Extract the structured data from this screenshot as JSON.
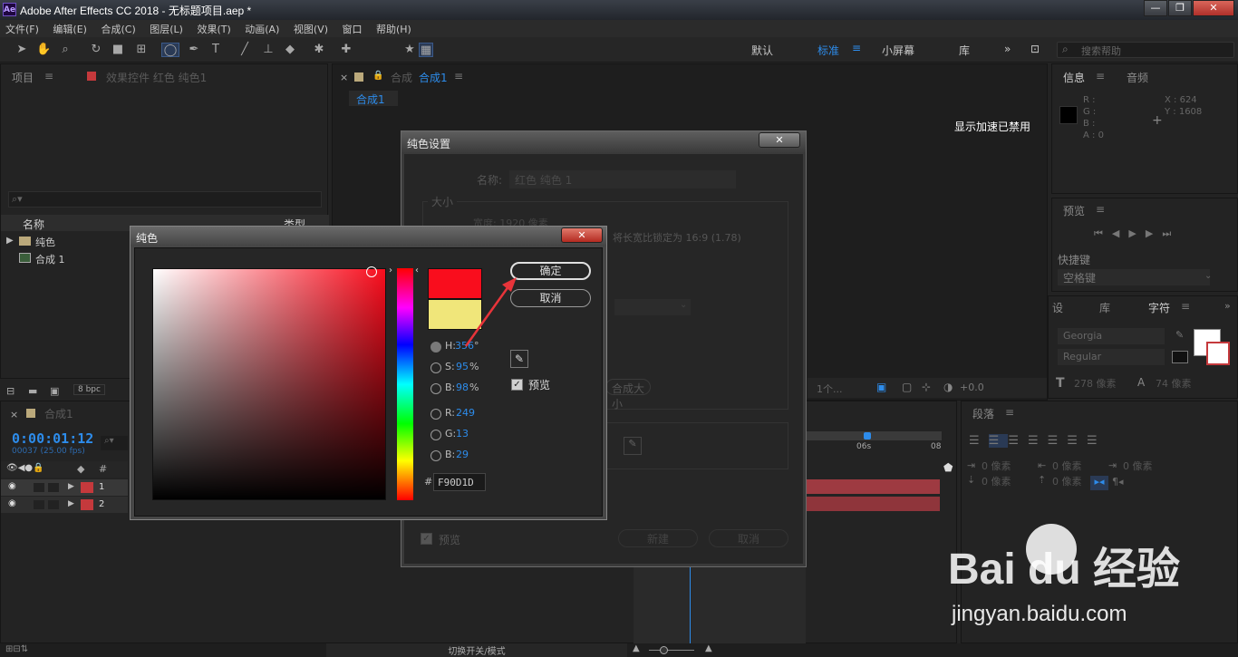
{
  "titlebar": {
    "logo": "Ae",
    "title": "Adobe After Effects CC 2018 - 无标题项目.aep *",
    "minimize": "—",
    "restore": "❐",
    "close": "✕"
  },
  "menu": [
    "文件(F)",
    "编辑(E)",
    "合成(C)",
    "图层(L)",
    "效果(T)",
    "动画(A)",
    "视图(V)",
    "窗口",
    "帮助(H)"
  ],
  "workspaces": [
    "默认",
    "标准",
    "小屏幕",
    "库"
  ],
  "search_placeholder": "搜索帮助",
  "project_panel": {
    "tab_project": "项目",
    "tab_effects": "效果控件 红色 纯色1",
    "col_name": "名称",
    "col_type": "类型",
    "items": [
      "纯色",
      "合成 1"
    ],
    "bpc": "8 bpc"
  },
  "comp_panel": {
    "tab_label": "合成",
    "tab_name": "合成1",
    "subtab": "合成1",
    "gpu_notice": "显示加速已禁用",
    "view_count": "1个...",
    "exposure": "+0.0"
  },
  "timeline": {
    "tab_name": "合成1",
    "timecode": "0:00:01:12",
    "frames": "00037 (25.00 fps)",
    "col_num": "#",
    "rows": [
      {
        "num": "1",
        "color": "#c5393c"
      },
      {
        "num": "2",
        "color": "#c5393c"
      }
    ],
    "ruler_marks": [
      "06s",
      "08"
    ],
    "footer_toggle": "切换开关/模式"
  },
  "info_panel": {
    "tab_info": "信息",
    "tab_audio": "音频",
    "r": "R :",
    "g": "G :",
    "b": "B :",
    "a": "A : 0",
    "x": "X : 624",
    "y": "Y : 1608"
  },
  "preview_panel": {
    "tab": "预览",
    "shortcut_label": "快捷键",
    "shortcut_value": "空格键"
  },
  "char_panel": {
    "tab_settings": "设",
    "tab_library": "库",
    "tab_char": "字符",
    "font": "Georgia",
    "style": "Regular",
    "size": "278 像素",
    "leading": "74 像素"
  },
  "paragraph_panel": {
    "tab": "段落",
    "indent1": "0 像素",
    "indent2": "0 像素",
    "indent3": "0 像素",
    "indent4": "0 像素",
    "indent5": "0 像素"
  },
  "solid_dialog": {
    "title": "纯色设置",
    "name_label": "名称:",
    "name_value": "红色 纯色 1",
    "size_label": "大小",
    "width_label": "宽度: 1920 像素",
    "aspect_lock": "将长宽比锁定为 16:9 (1.78)",
    "make_comp_size": "合成大小",
    "preview_label": "预览",
    "new_button": "新建",
    "cancel_button": "取消"
  },
  "color_dialog": {
    "title": "纯色",
    "ok_button": "确定",
    "cancel_button": "取消",
    "preview_label": "预览",
    "h_label": "H:",
    "h_value": "356",
    "h_unit": "°",
    "s_label": "S:",
    "s_value": "95",
    "s_unit": "%",
    "b_label": "B:",
    "b_value": "98",
    "b_unit": "%",
    "r_label": "R:",
    "r_value": "249",
    "g_label": "G:",
    "g_value": "13",
    "b2_label": "B:",
    "b2_value": "29",
    "hex_label": "#",
    "hex_value": "F90D1D",
    "new_color": "#f90d1d",
    "old_color": "#f0e67a"
  },
  "watermark": {
    "brand": "Bai du 经验",
    "url": "jingyan.baidu.com"
  }
}
